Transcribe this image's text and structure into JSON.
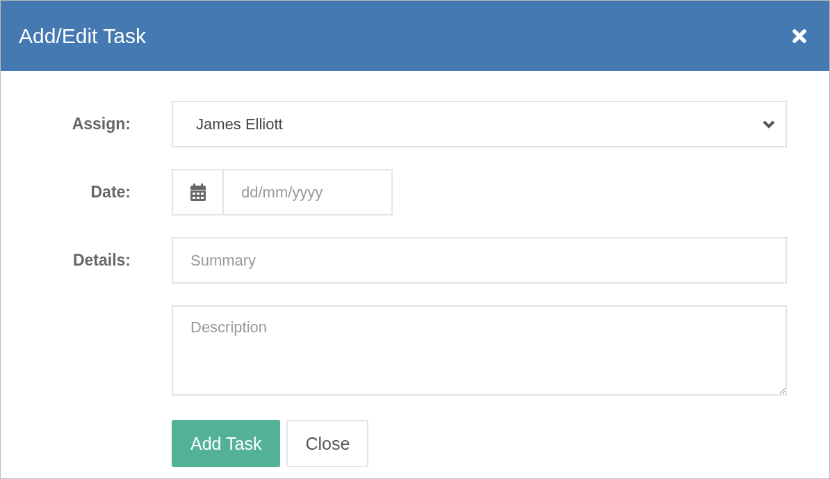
{
  "dialog": {
    "title": "Add/Edit Task"
  },
  "fields": [
    {
      "kind": "select",
      "label": "Assign:",
      "value": "James Elliott"
    },
    {
      "kind": "date",
      "label": "Date:",
      "placeholder": "dd/mm/yyyy"
    },
    {
      "kind": "text",
      "label": "Details:",
      "placeholder": "Summary"
    },
    {
      "kind": "textarea",
      "placeholder": "Description"
    }
  ],
  "buttons": [
    {
      "kind": "primary",
      "label": "Add Task"
    },
    {
      "kind": "secondary",
      "label": "Close"
    }
  ]
}
